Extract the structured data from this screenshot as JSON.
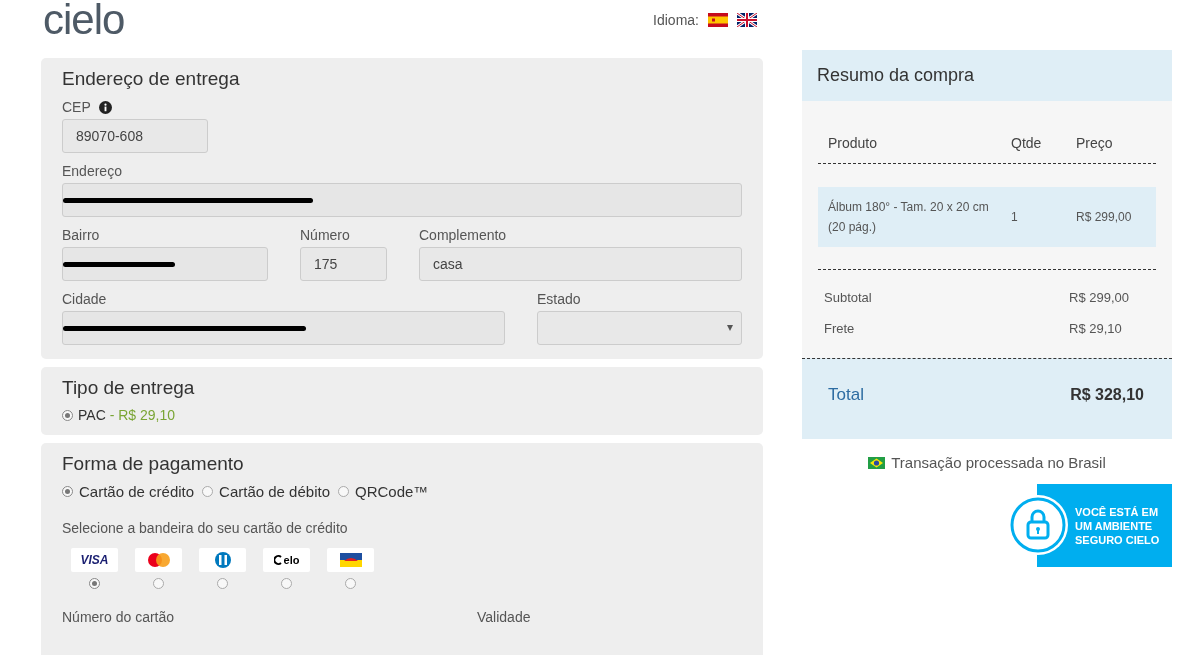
{
  "header": {
    "logo": "cielo",
    "language_label": "Idioma:",
    "flags": [
      {
        "kind": "spain"
      },
      {
        "kind": "uk"
      }
    ]
  },
  "address": {
    "title": "Endereço de entrega",
    "fields": [
      {
        "label": "CEP",
        "value": "89070-608",
        "info": true,
        "redacted": false,
        "kind": "text"
      },
      {
        "label": "Endereço",
        "info": false,
        "redacted": true,
        "kind": "text"
      },
      {
        "label": "Bairro",
        "info": false,
        "redacted": true,
        "kind": "text"
      },
      {
        "label": "Número",
        "value": "175",
        "info": false,
        "redacted": false,
        "kind": "text"
      },
      {
        "label": "Complemento",
        "value": "casa",
        "info": false,
        "redacted": false,
        "kind": "text"
      },
      {
        "label": "Cidade",
        "info": false,
        "redacted": true,
        "kind": "text"
      },
      {
        "label": "Estado",
        "info": false,
        "redacted": false,
        "kind": "select"
      }
    ]
  },
  "delivery": {
    "title": "Tipo de entrega",
    "options": [
      {
        "label": "PAC",
        "price": "- R$ 29,10",
        "selected": true
      }
    ]
  },
  "payment": {
    "title": "Forma de pagamento",
    "methods": [
      {
        "label": "Cartão de crédito",
        "selected": true
      },
      {
        "label": "Cartão de débito",
        "selected": false
      },
      {
        "label": "QRCode™",
        "selected": false
      }
    ],
    "brand_prompt": "Selecione a bandeira do seu cartão de crédito",
    "brands": [
      {
        "kind": "wordmark",
        "text": "VISA",
        "selected": true
      },
      {
        "kind": "two-circles",
        "selected": false
      },
      {
        "kind": "split-circle",
        "selected": false
      },
      {
        "kind": "elo",
        "text": "elo",
        "selected": false
      },
      {
        "kind": "banner",
        "selected": false
      }
    ],
    "field_labels": [
      "Número do cartão",
      "Validade"
    ]
  },
  "summary": {
    "title": "Resumo da compra",
    "columns": [
      "Produto",
      "Qtde",
      "Preço"
    ],
    "items": [
      {
        "product": "Álbum 180° - Tam. 20 x 20 cm (20 pág.)",
        "qty": "1",
        "price": "R$ 299,00"
      }
    ],
    "lines": [
      {
        "label": "Subtotal",
        "value": "R$ 299,00"
      },
      {
        "label": "Frete",
        "value": "R$ 29,10"
      }
    ],
    "total": {
      "label": "Total",
      "value": "R$ 328,10"
    }
  },
  "origin_note": "Transação processada no Brasil",
  "secure_badge": [
    "VOCÊ ESTÁ EM",
    "UM AMBIENTE",
    "SEGURO CIELO"
  ]
}
